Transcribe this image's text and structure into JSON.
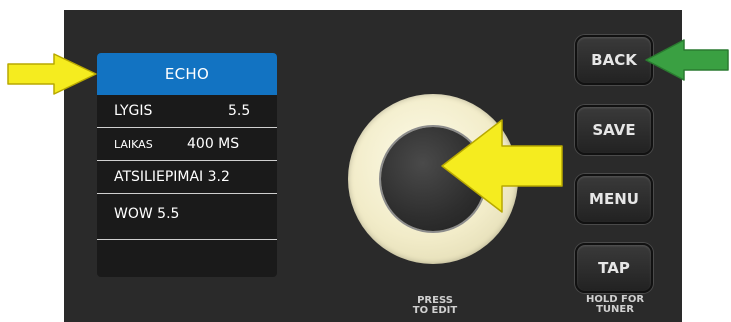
{
  "screen": {
    "header": "ECHO",
    "rows": [
      {
        "name": "LYGIS",
        "value": "5.5"
      },
      {
        "name": "LAIKAS",
        "value": "400 MS"
      },
      {
        "name": "ATSILIEPIMAI 3.2",
        "value": ""
      },
      {
        "name": "WOW 5.5",
        "value": ""
      }
    ]
  },
  "knob": {
    "caption_line1": "PRESS",
    "caption_line2": "TO EDIT"
  },
  "buttons": {
    "back": "BACK",
    "save": "SAVE",
    "menu": "MENU",
    "tap": "TAP"
  },
  "tap_caption": {
    "line1": "HOLD FOR",
    "line2": "TUNER"
  },
  "icons": {
    "left_arrow": "yellow-arrow-right-icon",
    "knob_arrow": "yellow-arrow-left-icon",
    "back_arrow": "green-arrow-left-icon"
  },
  "colors": {
    "panel": "#2a2a2a",
    "screen_header": "#1273c2",
    "yellow_arrow": "#f5ec1f",
    "green_arrow": "#3aa042",
    "knob_ring": "#f2ecc9"
  }
}
